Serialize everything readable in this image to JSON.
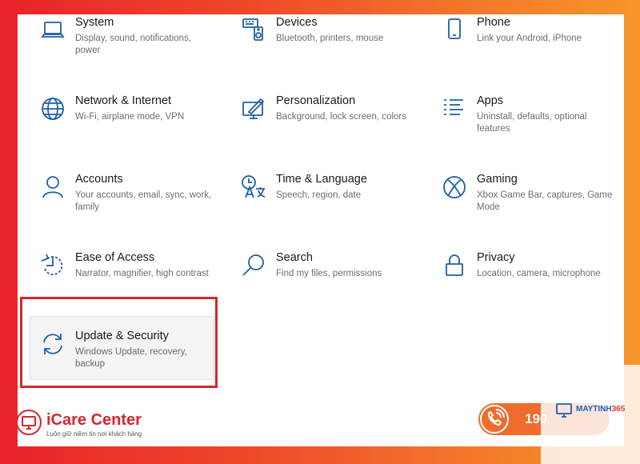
{
  "settings_tiles": [
    {
      "title": "System",
      "desc": "Display, sound, notifications, power",
      "icon": "laptop-icon"
    },
    {
      "title": "Devices",
      "desc": "Bluetooth, printers, mouse",
      "icon": "devices-icon"
    },
    {
      "title": "Phone",
      "desc": "Link your Android, iPhone",
      "icon": "phone-icon"
    },
    {
      "title": "Network & Internet",
      "desc": "Wi-Fi, airplane mode, VPN",
      "icon": "globe-icon"
    },
    {
      "title": "Personalization",
      "desc": "Background, lock screen, colors",
      "icon": "paintbrush-icon"
    },
    {
      "title": "Apps",
      "desc": "Uninstall, defaults, optional features",
      "icon": "apps-list-icon"
    },
    {
      "title": "Accounts",
      "desc": "Your accounts, email, sync, work, family",
      "icon": "person-icon"
    },
    {
      "title": "Time & Language",
      "desc": "Speech, region, date",
      "icon": "time-language-icon"
    },
    {
      "title": "Gaming",
      "desc": "Xbox Game Bar, captures, Game Mode",
      "icon": "xbox-icon"
    },
    {
      "title": "Ease of Access",
      "desc": "Narrator, magnifier, high contrast",
      "icon": "ease-of-access-icon"
    },
    {
      "title": "Search",
      "desc": "Find my files, permissions",
      "icon": "search-icon"
    },
    {
      "title": "Privacy",
      "desc": "Location, camera, microphone",
      "icon": "lock-icon"
    },
    {
      "title": "Update & Security",
      "desc": "Windows Update, recovery, backup",
      "icon": "sync-icon"
    }
  ],
  "highlight_color": "#d22a28",
  "watermarks": {
    "icare_name": "iCare Center",
    "icare_slogan": "Luôn giữ niềm tin nơi khách hàng",
    "hotline": "190",
    "maytinh": "MAYTINH",
    "maytinh_num": "365"
  }
}
